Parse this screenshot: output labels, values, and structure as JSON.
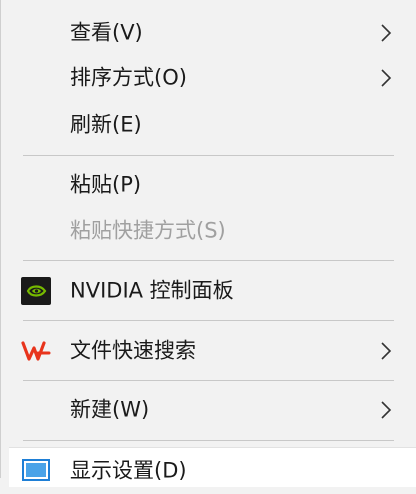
{
  "context_menu": {
    "items": [
      {
        "label": "查看(V)",
        "has_submenu": true
      },
      {
        "label": "排序方式(O)",
        "has_submenu": true
      },
      {
        "label": "刷新(E)",
        "has_submenu": false
      },
      {
        "label": "粘贴(P)",
        "has_submenu": false
      },
      {
        "label": "粘贴快捷方式(S)",
        "has_submenu": false,
        "disabled": true
      },
      {
        "label": "NVIDIA 控制面板",
        "has_submenu": false,
        "icon": "nvidia-icon"
      },
      {
        "label": "文件快速搜索",
        "has_submenu": true,
        "icon": "wps-icon"
      },
      {
        "label": "新建(W)",
        "has_submenu": true
      },
      {
        "label": "显示设置(D)",
        "has_submenu": false,
        "icon": "display-icon"
      }
    ]
  },
  "colors": {
    "menu_background": "#f2f2f2",
    "disabled_text": "#a0a0a0",
    "nvidia_green": "#76b900",
    "wps_red": "#e8341c",
    "display_blue": "#1e7fd6"
  }
}
